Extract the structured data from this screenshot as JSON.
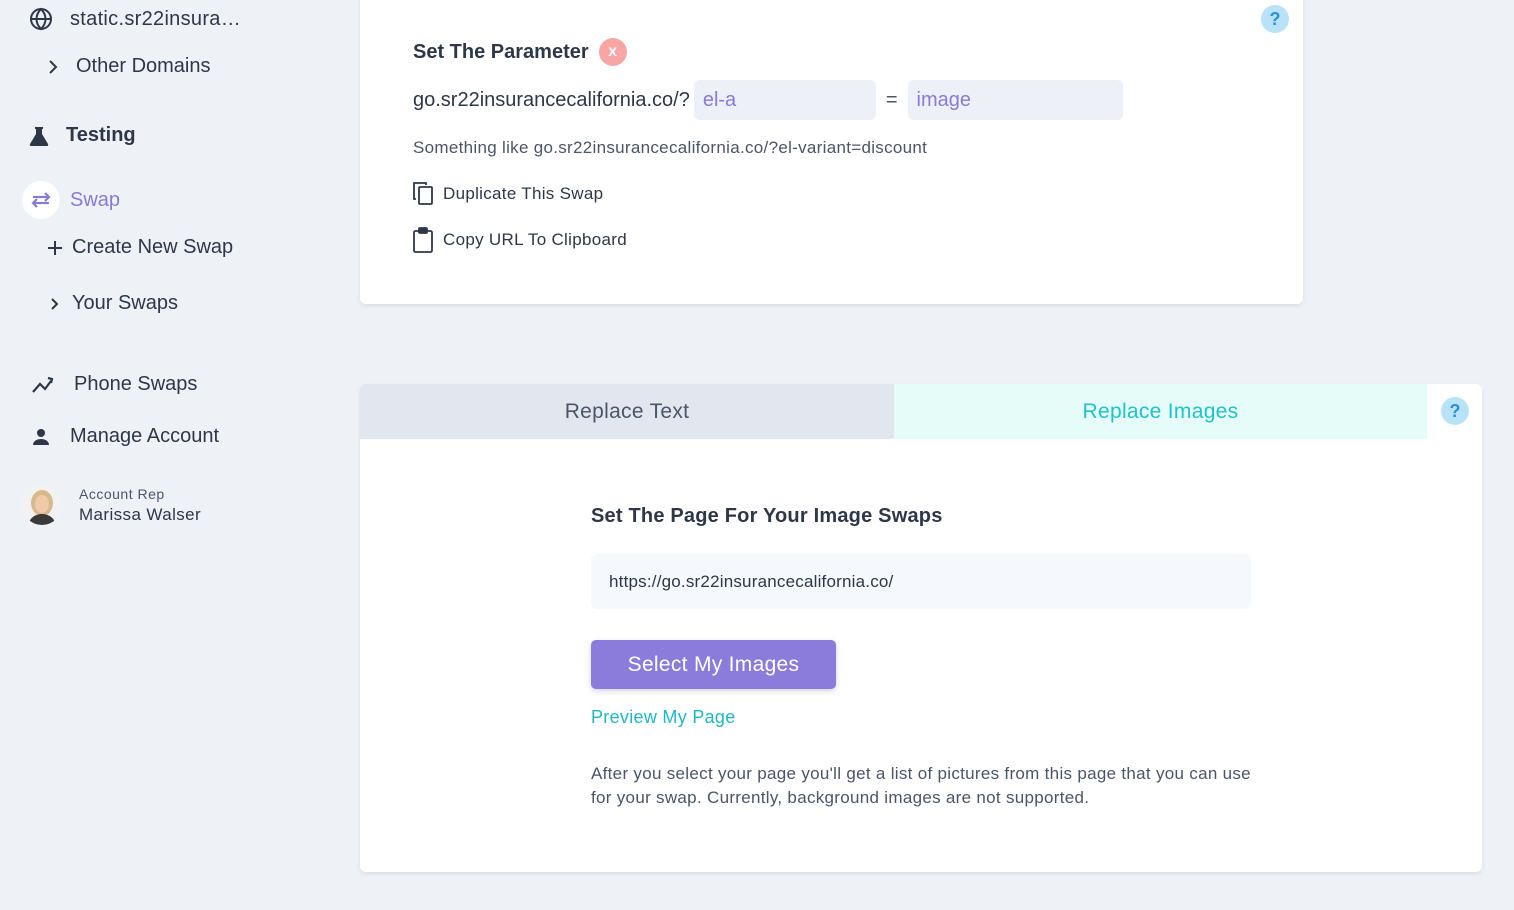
{
  "sidebar": {
    "domain": "static.sr22insura…",
    "other_domains": "Other Domains",
    "testing": "Testing",
    "swap": "Swap",
    "create_new_swap": "Create New Swap",
    "your_swaps": "Your Swaps",
    "phone_swaps": "Phone Swaps",
    "manage_account": "Manage Account",
    "account_rep_label": "Account Rep",
    "account_rep_name": "Marissa Walser"
  },
  "parameter_card": {
    "help": "?",
    "title": "Set The Parameter",
    "close": "x",
    "url_prefix": "go.sr22insurancecalifornia.co/?",
    "key_value": "el-a",
    "equals": "=",
    "value_value": "image",
    "hint": "Something like go.sr22insurancecalifornia.co/?el-variant=discount",
    "duplicate": "Duplicate This Swap",
    "copy_url": "Copy URL To Clipboard"
  },
  "swap_card": {
    "tabs": [
      "Replace Text",
      "Replace Images"
    ],
    "active_tab": "Replace Images",
    "help": "?",
    "section_title": "Set The Page For Your Image Swaps",
    "page_url": "https://go.sr22insurancecalifornia.co/",
    "select_button": "Select My Images",
    "preview_link": "Preview My Page",
    "note": "After you select your page you'll get a list of pictures from this page that you can use for your swap. Currently, background images are not supported."
  },
  "colors": {
    "accent_purple": "#8b7bdb",
    "accent_teal": "#1fc3c9",
    "background": "#eef1f6",
    "help_blue": "#b8e2f8",
    "close_red": "#f8a5a5"
  }
}
